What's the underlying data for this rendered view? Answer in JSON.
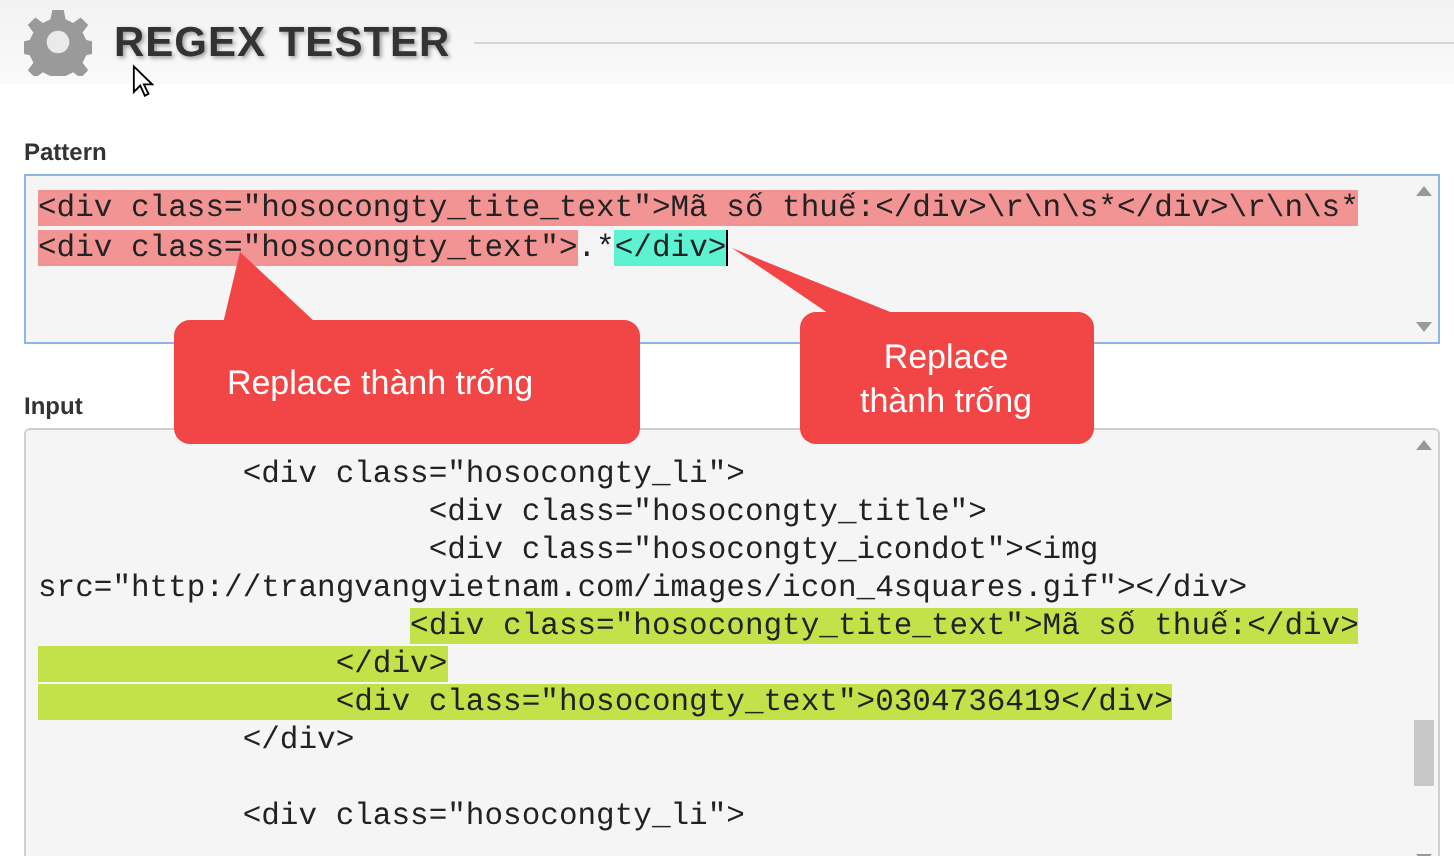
{
  "title": "REGEX TESTER",
  "pattern": {
    "label": "Pattern",
    "lines": [
      {
        "segments": [
          {
            "text": "<div class=\"hosocongty_tite_text\">Mã số thuế:</div>\\r\\n\\s*</div>\\r\\n\\s*",
            "kind": "group"
          }
        ]
      },
      {
        "segments": [
          {
            "text": "<div class=\"hosocongty_text\">",
            "kind": "group"
          },
          {
            "text": ".*",
            "kind": "plain"
          },
          {
            "text": "</div>",
            "kind": "end"
          }
        ]
      }
    ]
  },
  "input": {
    "label": "Input",
    "blocks": [
      {
        "lines": [
          {
            "segments": [
              {
                "text": "           <div class=\"hosocongty_li\">",
                "kind": "plain"
              }
            ]
          },
          {
            "segments": [
              {
                "text": "                     <div class=\"hosocongty_title\">",
                "kind": "plain"
              }
            ]
          },
          {
            "segments": [
              {
                "text": "                     <div class=\"hosocongty_icondot\"><img",
                "kind": "plain"
              }
            ]
          },
          {
            "segments": [
              {
                "text": "src=\"http://trangvangvietnam.com/images/icon_4squares.gif\"></div>",
                "kind": "plain"
              }
            ]
          },
          {
            "segments": [
              {
                "text": "                    <div class=\"hosocongty_tite_text\">Mã số thuế:</div>",
                "kind": "match_after_indent"
              }
            ]
          },
          {
            "segments": [
              {
                "text": "                </div>",
                "kind": "match"
              }
            ]
          },
          {
            "segments": [
              {
                "text": "                <div class=\"hosocongty_text\">0304736419</div>",
                "kind": "match"
              }
            ]
          },
          {
            "segments": [
              {
                "text": "           </div>",
                "kind": "plain"
              }
            ]
          }
        ]
      },
      {
        "lines": [
          {
            "segments": [
              {
                "text": "           <div class=\"hosocongty_li\">",
                "kind": "plain"
              }
            ]
          }
        ]
      }
    ]
  },
  "callouts": [
    {
      "lines": [
        "Replace thành trống"
      ]
    },
    {
      "lines": [
        "Replace",
        "thành trống"
      ]
    }
  ]
}
